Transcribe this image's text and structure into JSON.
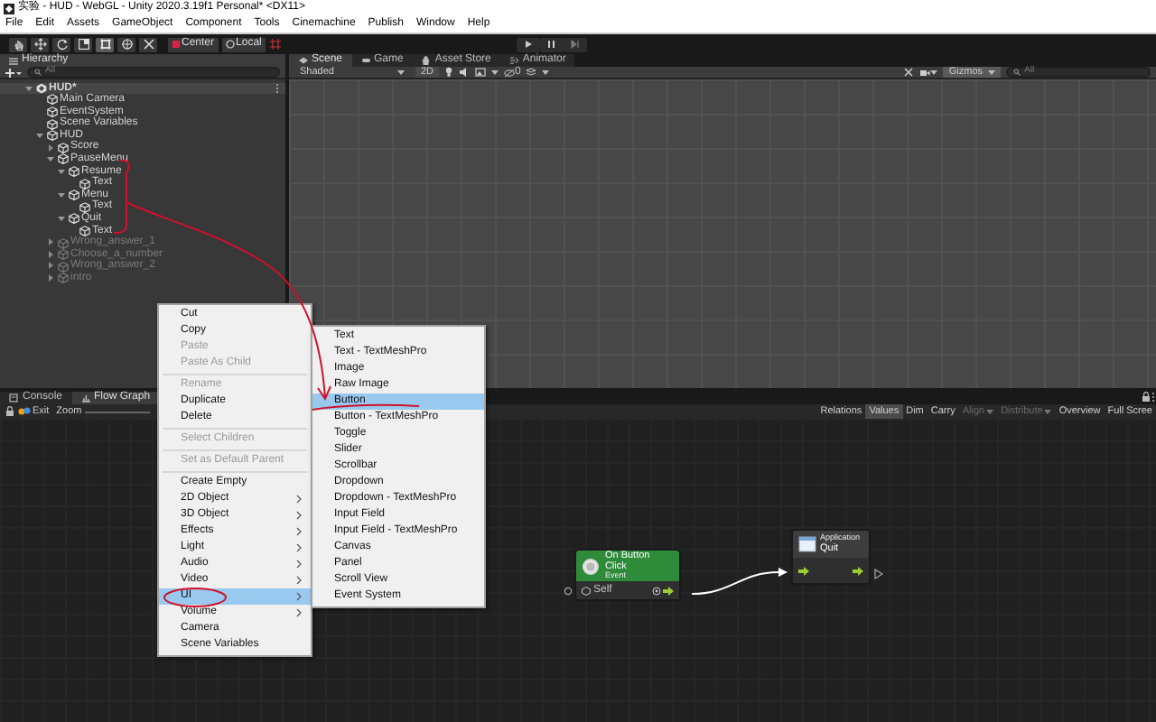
{
  "window": {
    "title": "实验 - HUD - WebGL - Unity 2020.3.19f1 Personal* <DX11>"
  },
  "menu_bar": [
    "File",
    "Edit",
    "Assets",
    "GameObject",
    "Component",
    "Tools",
    "Cinemachine",
    "Publish",
    "Window",
    "Help"
  ],
  "toolbar": {
    "tools": [
      {
        "kind": "hand",
        "selected": false
      },
      {
        "kind": "move",
        "selected": false
      },
      {
        "kind": "rotate",
        "selected": false
      },
      {
        "kind": "scale",
        "selected": false
      },
      {
        "kind": "rect",
        "selected": true
      },
      {
        "kind": "transform",
        "selected": false
      },
      {
        "kind": "custom",
        "selected": false
      }
    ],
    "pivot": [
      "Center",
      "Local"
    ]
  },
  "hierarchy": {
    "title": "Hierarchy",
    "search_placeholder": "All",
    "tree": [
      {
        "label": "HUD*",
        "kind": "scene",
        "expanded": true,
        "children": [
          {
            "label": "Main Camera",
            "active": true
          },
          {
            "label": "EventSystem",
            "active": true
          },
          {
            "label": "Scene Variables",
            "active": true
          },
          {
            "label": "HUD",
            "active": true,
            "expanded": true,
            "children": [
              {
                "label": "Score",
                "active": true,
                "expanded": false
              },
              {
                "label": "PauseMenu",
                "active": true,
                "expanded": true,
                "children": [
                  {
                    "label": "Resume",
                    "active": true,
                    "expanded": true,
                    "children": [
                      {
                        "label": "Text",
                        "active": true
                      }
                    ]
                  },
                  {
                    "label": "Menu",
                    "active": true,
                    "expanded": true,
                    "children": [
                      {
                        "label": "Text",
                        "active": true
                      }
                    ]
                  },
                  {
                    "label": "Quit",
                    "active": true,
                    "expanded": true,
                    "children": [
                      {
                        "label": "Text",
                        "active": true
                      }
                    ]
                  }
                ]
              },
              {
                "label": "Wrong_answer_1",
                "active": false,
                "expanded": false
              },
              {
                "label": "Choose_a_number",
                "active": false,
                "expanded": false
              },
              {
                "label": "Wrong_answer_2",
                "active": false,
                "expanded": false
              },
              {
                "label": "intro",
                "active": false,
                "expanded": false
              }
            ]
          }
        ]
      }
    ]
  },
  "scene_view": {
    "tabs": [
      {
        "label": "Scene",
        "kind": "scene",
        "selected": true
      },
      {
        "label": "Game",
        "kind": "game",
        "selected": false
      },
      {
        "label": "Asset Store",
        "kind": "store",
        "selected": false
      },
      {
        "label": "Animator",
        "kind": "animator",
        "selected": false
      }
    ],
    "shading": "Shaded",
    "mode_2d": "2D",
    "hidden_count": "0",
    "gizmos": "Gizmos",
    "search_placeholder": "All"
  },
  "bottom_panel": {
    "tabs": [
      {
        "label": "Console",
        "kind": "console",
        "selected": false
      },
      {
        "label": "Flow Graph",
        "kind": "graph",
        "selected": true
      }
    ],
    "breadcrumb": "Exit",
    "zoom_label": "Zoom",
    "options": [
      {
        "label": "Relations",
        "selected": false,
        "disabled": false,
        "dropdown": false
      },
      {
        "label": "Values",
        "selected": true,
        "disabled": false,
        "dropdown": false
      },
      {
        "label": "Dim",
        "selected": false,
        "disabled": false,
        "dropdown": false
      },
      {
        "label": "Carry",
        "selected": false,
        "disabled": false,
        "dropdown": false
      },
      {
        "label": "Align",
        "selected": false,
        "disabled": true,
        "dropdown": true
      },
      {
        "label": "Distribute",
        "selected": false,
        "disabled": true,
        "dropdown": true
      },
      {
        "label": "Overview",
        "selected": false,
        "disabled": false,
        "dropdown": false
      },
      {
        "label": "Full Scree",
        "selected": false,
        "disabled": false,
        "dropdown": false
      }
    ]
  },
  "graph": {
    "nodes": [
      {
        "kind": "event",
        "title": "On Button Click",
        "subtitle": "Event",
        "port_label": "Self"
      },
      {
        "kind": "action",
        "category": "Application",
        "title": "Quit"
      }
    ]
  },
  "context_menu": {
    "items": [
      {
        "kind": "item",
        "label": "Cut",
        "disabled": false,
        "selected": false
      },
      {
        "kind": "item",
        "label": "Copy",
        "disabled": false,
        "selected": false
      },
      {
        "kind": "item",
        "label": "Paste",
        "disabled": true,
        "selected": false
      },
      {
        "kind": "item",
        "label": "Paste As Child",
        "disabled": true,
        "selected": false
      },
      {
        "kind": "separator"
      },
      {
        "kind": "item",
        "label": "Rename",
        "disabled": true,
        "selected": false
      },
      {
        "kind": "item",
        "label": "Duplicate",
        "disabled": false,
        "selected": false
      },
      {
        "kind": "item",
        "label": "Delete",
        "disabled": false,
        "selected": false
      },
      {
        "kind": "separator"
      },
      {
        "kind": "item",
        "label": "Select Children",
        "disabled": true,
        "selected": false
      },
      {
        "kind": "separator"
      },
      {
        "kind": "item",
        "label": "Set as Default Parent",
        "disabled": true,
        "selected": false
      },
      {
        "kind": "separator"
      },
      {
        "kind": "item",
        "label": "Create Empty",
        "disabled": false,
        "selected": false
      },
      {
        "kind": "submenu",
        "label": "2D Object",
        "disabled": false,
        "selected": false
      },
      {
        "kind": "submenu",
        "label": "3D Object",
        "disabled": false,
        "selected": false
      },
      {
        "kind": "submenu",
        "label": "Effects",
        "disabled": false,
        "selected": false
      },
      {
        "kind": "submenu",
        "label": "Light",
        "disabled": false,
        "selected": false
      },
      {
        "kind": "submenu",
        "label": "Audio",
        "disabled": false,
        "selected": false
      },
      {
        "kind": "submenu",
        "label": "Video",
        "disabled": false,
        "selected": false
      },
      {
        "kind": "submenu",
        "label": "UI",
        "disabled": false,
        "selected": true
      },
      {
        "kind": "submenu",
        "label": "Volume",
        "disabled": false,
        "selected": false
      },
      {
        "kind": "item",
        "label": "Camera",
        "disabled": false,
        "selected": false
      },
      {
        "kind": "item",
        "label": "Scene Variables",
        "disabled": false,
        "selected": false
      }
    ]
  },
  "submenu": {
    "items": [
      {
        "label": "Text",
        "selected": false
      },
      {
        "label": "Text - TextMeshPro",
        "selected": false
      },
      {
        "label": "Image",
        "selected": false
      },
      {
        "label": "Raw Image",
        "selected": false
      },
      {
        "label": "Button",
        "selected": true
      },
      {
        "label": "Button - TextMeshPro",
        "selected": false
      },
      {
        "label": "Toggle",
        "selected": false
      },
      {
        "label": "Slider",
        "selected": false
      },
      {
        "label": "Scrollbar",
        "selected": false
      },
      {
        "label": "Dropdown",
        "selected": false
      },
      {
        "label": "Dropdown - TextMeshPro",
        "selected": false
      },
      {
        "label": "Input Field",
        "selected": false
      },
      {
        "label": "Input Field - TextMeshPro",
        "selected": false
      },
      {
        "label": "Canvas",
        "selected": false
      },
      {
        "label": "Panel",
        "selected": false
      },
      {
        "label": "Scroll View",
        "selected": false
      },
      {
        "label": "Event System",
        "selected": false
      }
    ]
  }
}
